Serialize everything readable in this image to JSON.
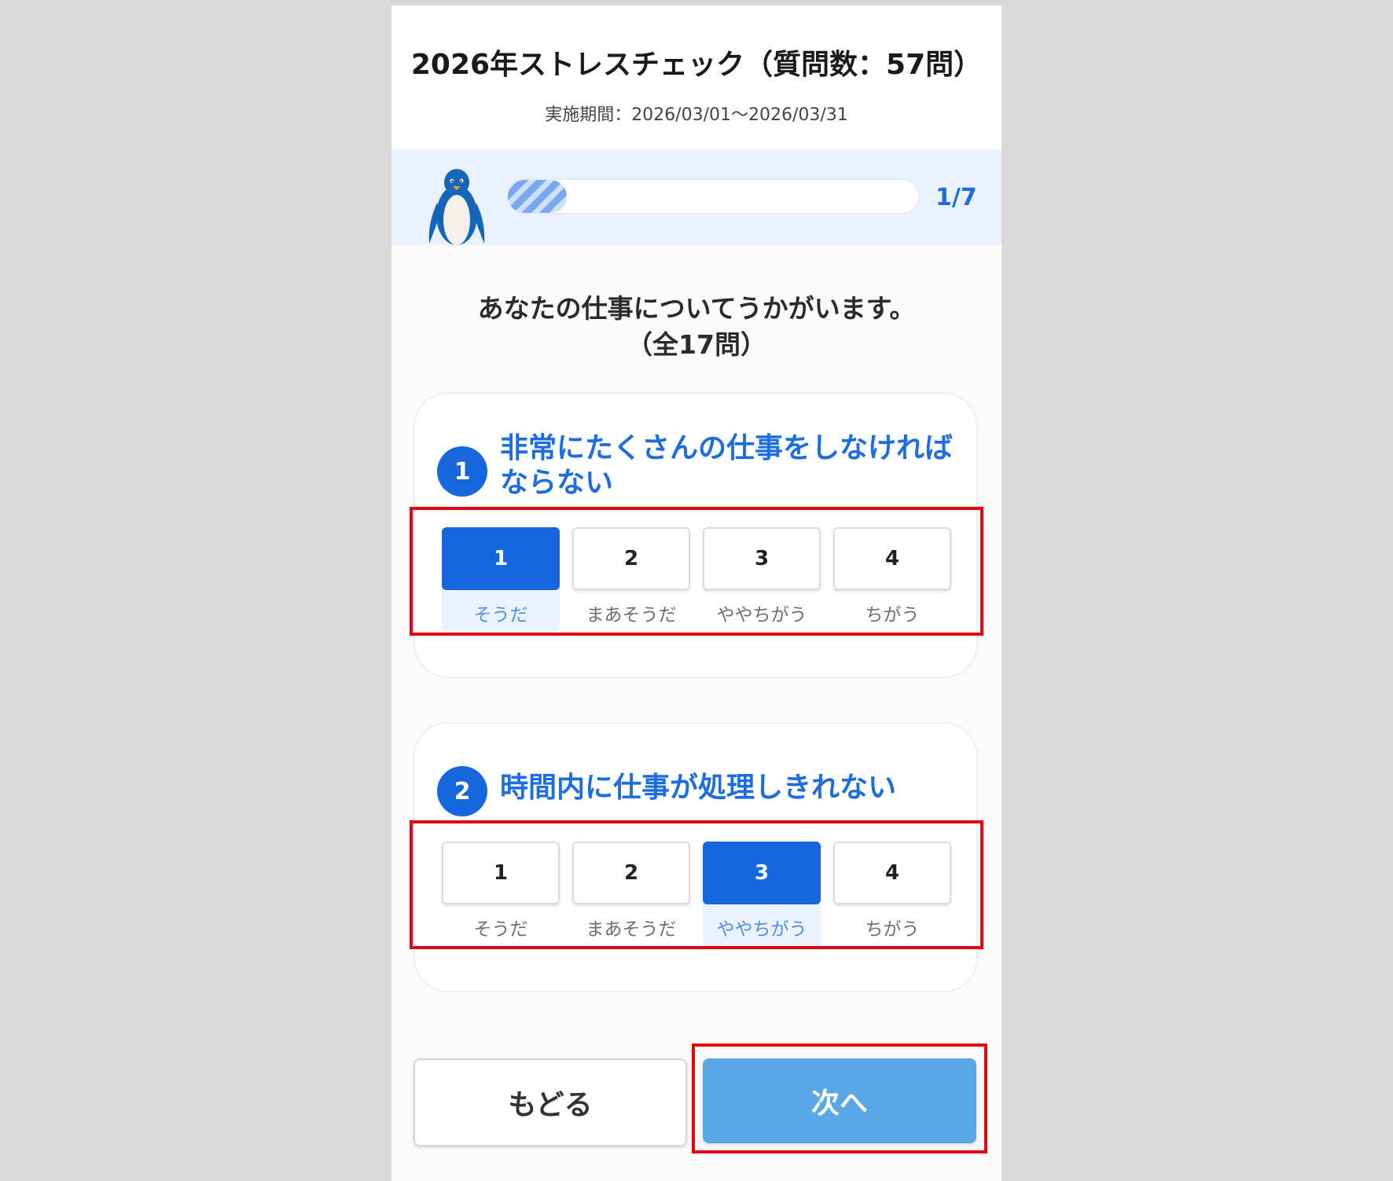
{
  "header": {
    "title": "2026年ストレスチェック（質問数：57問）",
    "period": "実施期間：2026/03/01～2026/03/31"
  },
  "progress": {
    "label": "1/7",
    "current_page": 1,
    "total_pages": 7,
    "fill_fraction": 0.143,
    "accent_color": "#1e6de0",
    "mascot_icon": "penguin-icon"
  },
  "section": {
    "heading_line1": "あなたの仕事についてうかがいます。",
    "heading_line2": "（全17問）"
  },
  "questions": [
    {
      "number": "1",
      "text": "非常にたくさんの仕事をしなければならない",
      "selected": 1,
      "choices": [
        {
          "value": "1",
          "label": "そうだ"
        },
        {
          "value": "2",
          "label": "まあそうだ"
        },
        {
          "value": "3",
          "label": "ややちがう"
        },
        {
          "value": "4",
          "label": "ちがう"
        }
      ]
    },
    {
      "number": "2",
      "text": "時間内に仕事が処理しきれない",
      "selected": 3,
      "choices": [
        {
          "value": "1",
          "label": "そうだ"
        },
        {
          "value": "2",
          "label": "まあそうだ"
        },
        {
          "value": "3",
          "label": "ややちがう"
        },
        {
          "value": "4",
          "label": "ちがう"
        }
      ]
    }
  ],
  "footer": {
    "back_label": "もどる",
    "next_label": "次へ"
  },
  "colors": {
    "selected": "#1667de",
    "next_button": "#5aa7e8",
    "highlight_border": "#e5000f"
  }
}
